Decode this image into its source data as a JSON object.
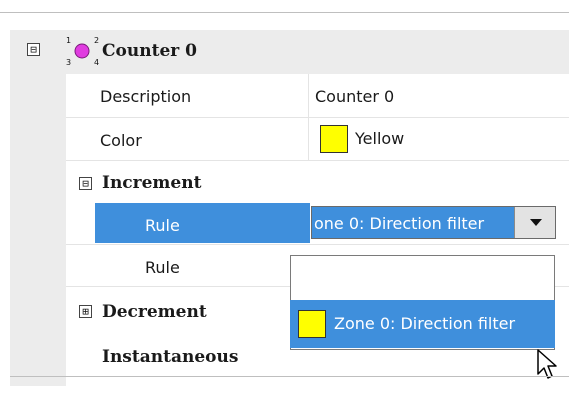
{
  "counter": {
    "title": "Counter 0",
    "counter_icon": "counter-numbers-icon",
    "expander_symbol": "⊟"
  },
  "properties": {
    "description": {
      "label": "Description",
      "value": "Counter 0"
    },
    "color": {
      "label": "Color",
      "value": "Yellow",
      "swatch": "#ffff00"
    }
  },
  "increment": {
    "title": "Increment",
    "expander_symbol": "⊟",
    "rules": [
      {
        "label": "Rule",
        "value": "one 0: Direction filter",
        "selected": true
      },
      {
        "label": "Rule",
        "value": ""
      }
    ]
  },
  "decrement": {
    "title": "Decrement",
    "expander_symbol": "⊞"
  },
  "instantaneous": {
    "title": "Instantaneous"
  },
  "dropdown": {
    "options": [
      {
        "label": ""
      },
      {
        "label": "Zone 0: Direction filter",
        "swatch": "#ffff00",
        "highlighted": true
      }
    ]
  },
  "colors": {
    "selection": "#3f8fdc",
    "gutter": "#ececec",
    "swatch_yellow": "#ffff00"
  }
}
